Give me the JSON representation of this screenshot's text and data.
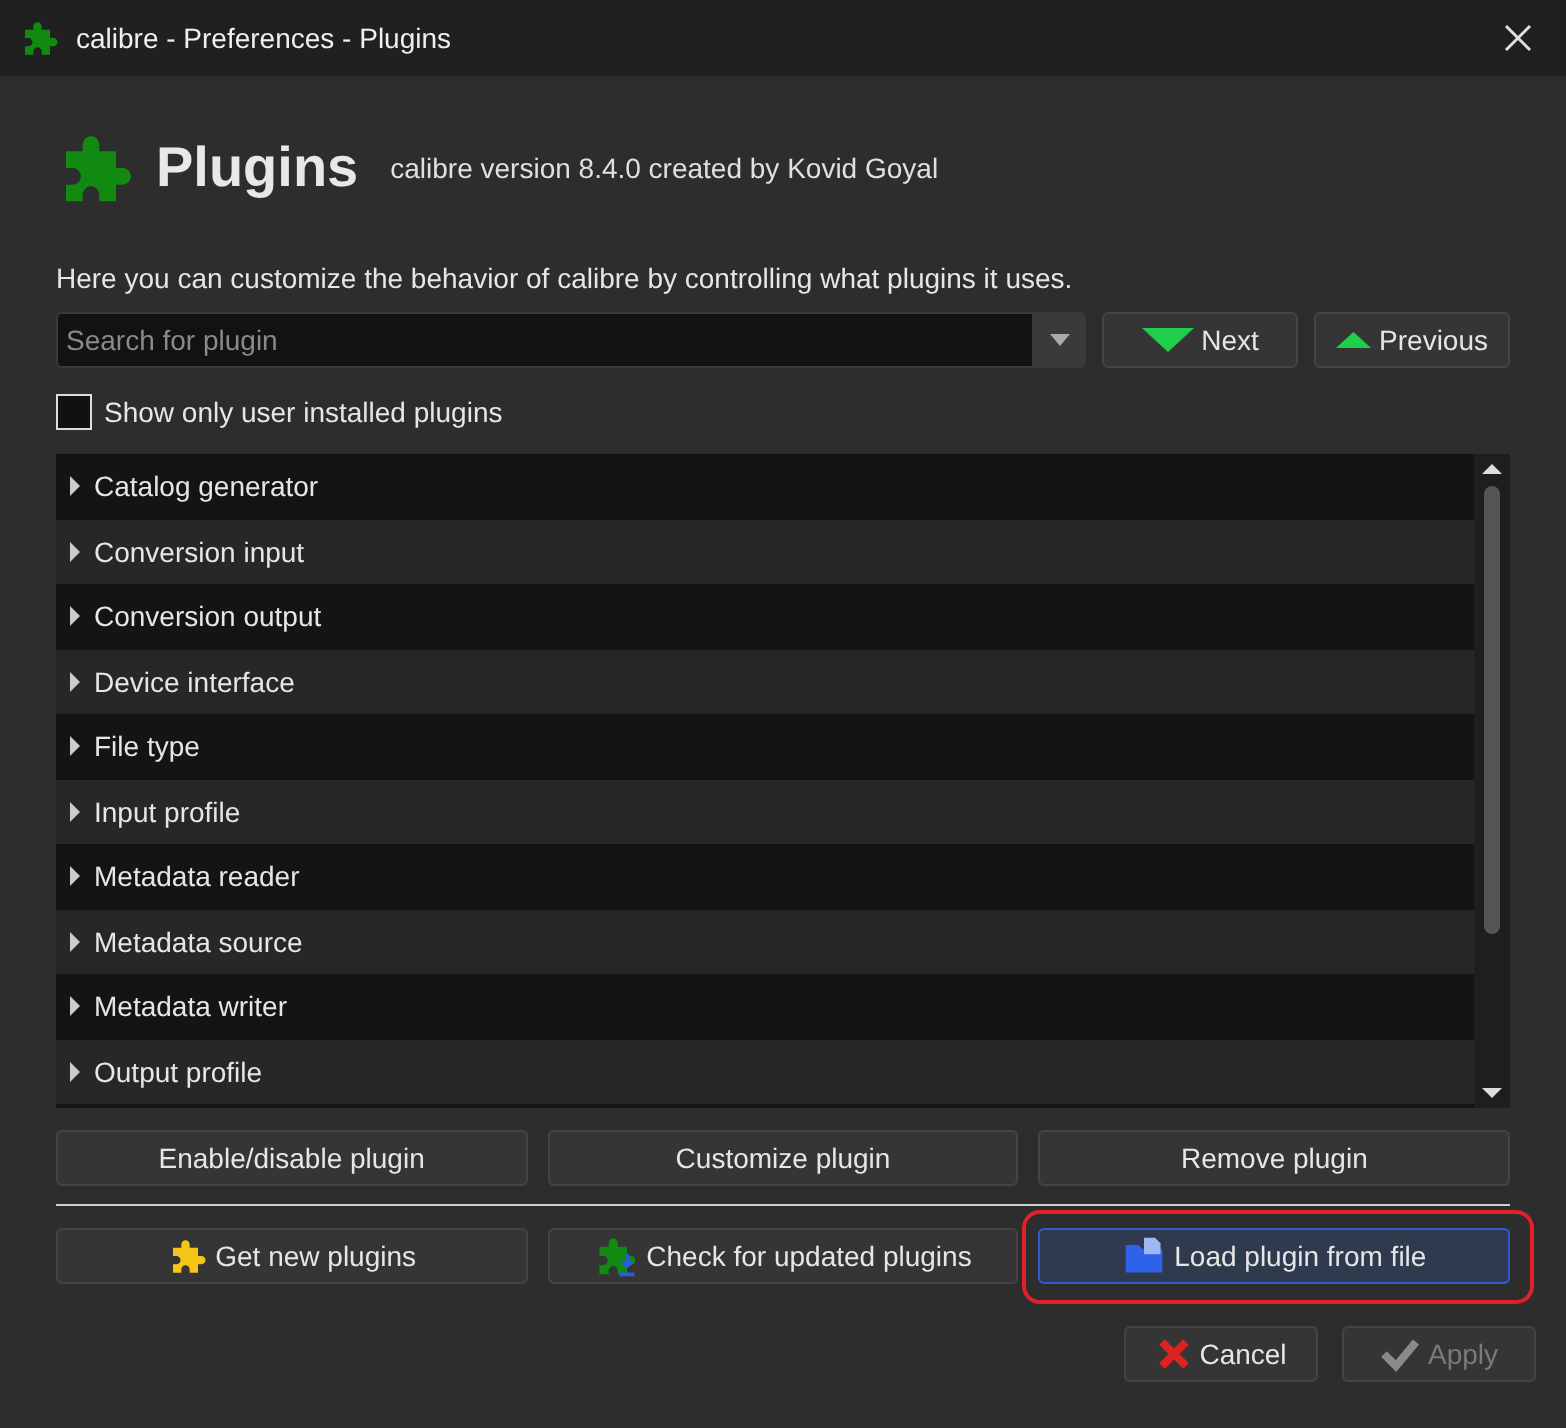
{
  "window": {
    "title": "calibre - Preferences - Plugins"
  },
  "header": {
    "title": "Plugins",
    "subtitle": "calibre version 8.4.0 created by Kovid Goyal"
  },
  "description": "Here you can customize the behavior of calibre by controlling what plugins it uses.",
  "search": {
    "placeholder": "Search for plugin"
  },
  "nav_buttons": [
    {
      "label": "Next",
      "kind": "down"
    },
    {
      "label": "Previous",
      "kind": "up"
    }
  ],
  "user_only": {
    "label": "Show only user installed plugins",
    "checked": false
  },
  "categories": [
    {
      "label": "Catalog generator",
      "expanded": false
    },
    {
      "label": "Conversion input",
      "expanded": false
    },
    {
      "label": "Conversion output",
      "expanded": false
    },
    {
      "label": "Device interface",
      "expanded": false
    },
    {
      "label": "File type",
      "expanded": false
    },
    {
      "label": "Input profile",
      "expanded": false
    },
    {
      "label": "Metadata reader",
      "expanded": false
    },
    {
      "label": "Metadata source",
      "expanded": false
    },
    {
      "label": "Metadata writer",
      "expanded": false
    },
    {
      "label": "Output profile",
      "expanded": false
    }
  ],
  "plugin_buttons": [
    {
      "label": "Enable/disable plugin"
    },
    {
      "label": "Customize plugin"
    },
    {
      "label": "Remove plugin"
    }
  ],
  "source_buttons": [
    {
      "label": "Get new plugins",
      "kind": "get",
      "highlighted": false
    },
    {
      "label": "Check for updated plugins",
      "kind": "update",
      "highlighted": false
    },
    {
      "label": "Load plugin from file",
      "kind": "file",
      "highlighted": true
    }
  ],
  "dialog_buttons": [
    {
      "label": "Cancel",
      "kind": "cancel",
      "disabled": false
    },
    {
      "label": "Apply",
      "kind": "apply",
      "disabled": true
    }
  ]
}
